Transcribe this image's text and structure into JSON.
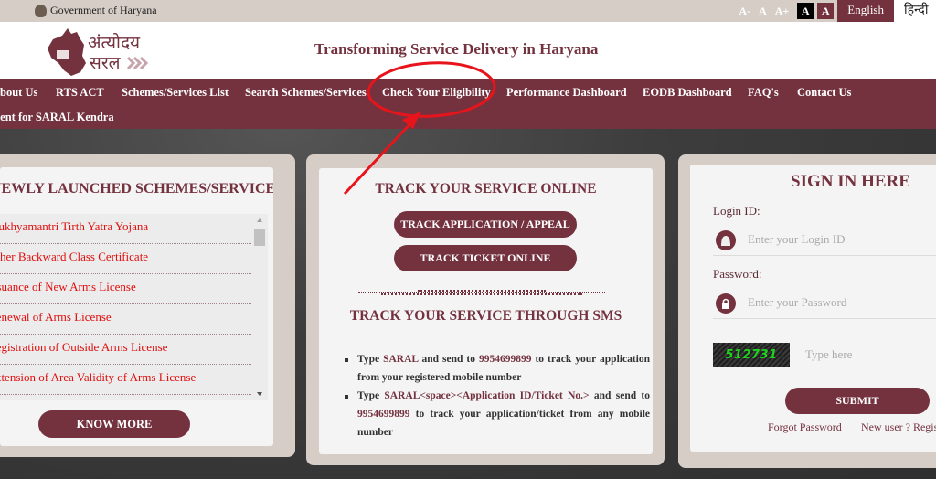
{
  "topbar": {
    "gov_label": "Government of Haryana",
    "font_sizes": [
      "A-",
      "A",
      "A+"
    ],
    "contrast": [
      "A",
      "A"
    ],
    "lang_english": "English",
    "lang_hindi": "हिन्दी"
  },
  "header": {
    "logo_text_line1": "अंत्योदय",
    "logo_text_line2": "सरल",
    "tagline": "Transforming Service Delivery in Haryana"
  },
  "nav": {
    "items": [
      "About Us",
      "RTS ACT",
      "Schemes/Services List",
      "Search Schemes/Services",
      "Check Your Eligibility",
      "Performance Dashboard",
      "EODB Dashboard",
      "FAQ's",
      "Contact Us",
      "Appointment for SARAL Kendra"
    ]
  },
  "schemes_card": {
    "title": "NEWLY LAUNCHED SCHEMES/SERVICES",
    "items": [
      "Mukhyamantri Tirth Yatra Yojana",
      "Other Backward Class Certificate",
      "Issuance of New Arms License",
      "Renewal of Arms License",
      "Registration of Outside Arms License",
      "Extension of Area Validity of Arms License"
    ],
    "know_more": "KNOW MORE"
  },
  "track_card": {
    "title_online": "TRACK YOUR SERVICE ONLINE",
    "btn_application": "TRACK APPLICATION / APPEAL",
    "btn_ticket": "TRACK TICKET ONLINE",
    "title_sms": "TRACK YOUR SERVICE THROUGH SMS",
    "sms": [
      {
        "pre": "Type ",
        "code": "SARAL",
        "mid": " and send to ",
        "number": "9954699899",
        "post": " to track your application from your registered mobile number"
      },
      {
        "pre": "Type ",
        "code": "SARAL<space><Application ID/Ticket No.>",
        "mid": " and send to ",
        "number": "9954699899",
        "post": " to track your application/ticket from any mobile number"
      }
    ]
  },
  "signin_card": {
    "title": "SIGN IN HERE",
    "login_label": "Login ID:",
    "login_placeholder": "Enter your Login ID",
    "password_label": "Password:",
    "password_placeholder": "Enter your Password",
    "captcha_code": "512731",
    "captcha_placeholder": "Type here",
    "submit": "SUBMIT",
    "forgot": "Forgot Password",
    "register": "New user ? Register"
  },
  "colors": {
    "brand_maroon": "#74323f",
    "topbar_bg": "#d6cdc7",
    "link_red": "#e00e0e",
    "annotation_red": "#e8141b",
    "captcha_green": "#1ed21e"
  }
}
